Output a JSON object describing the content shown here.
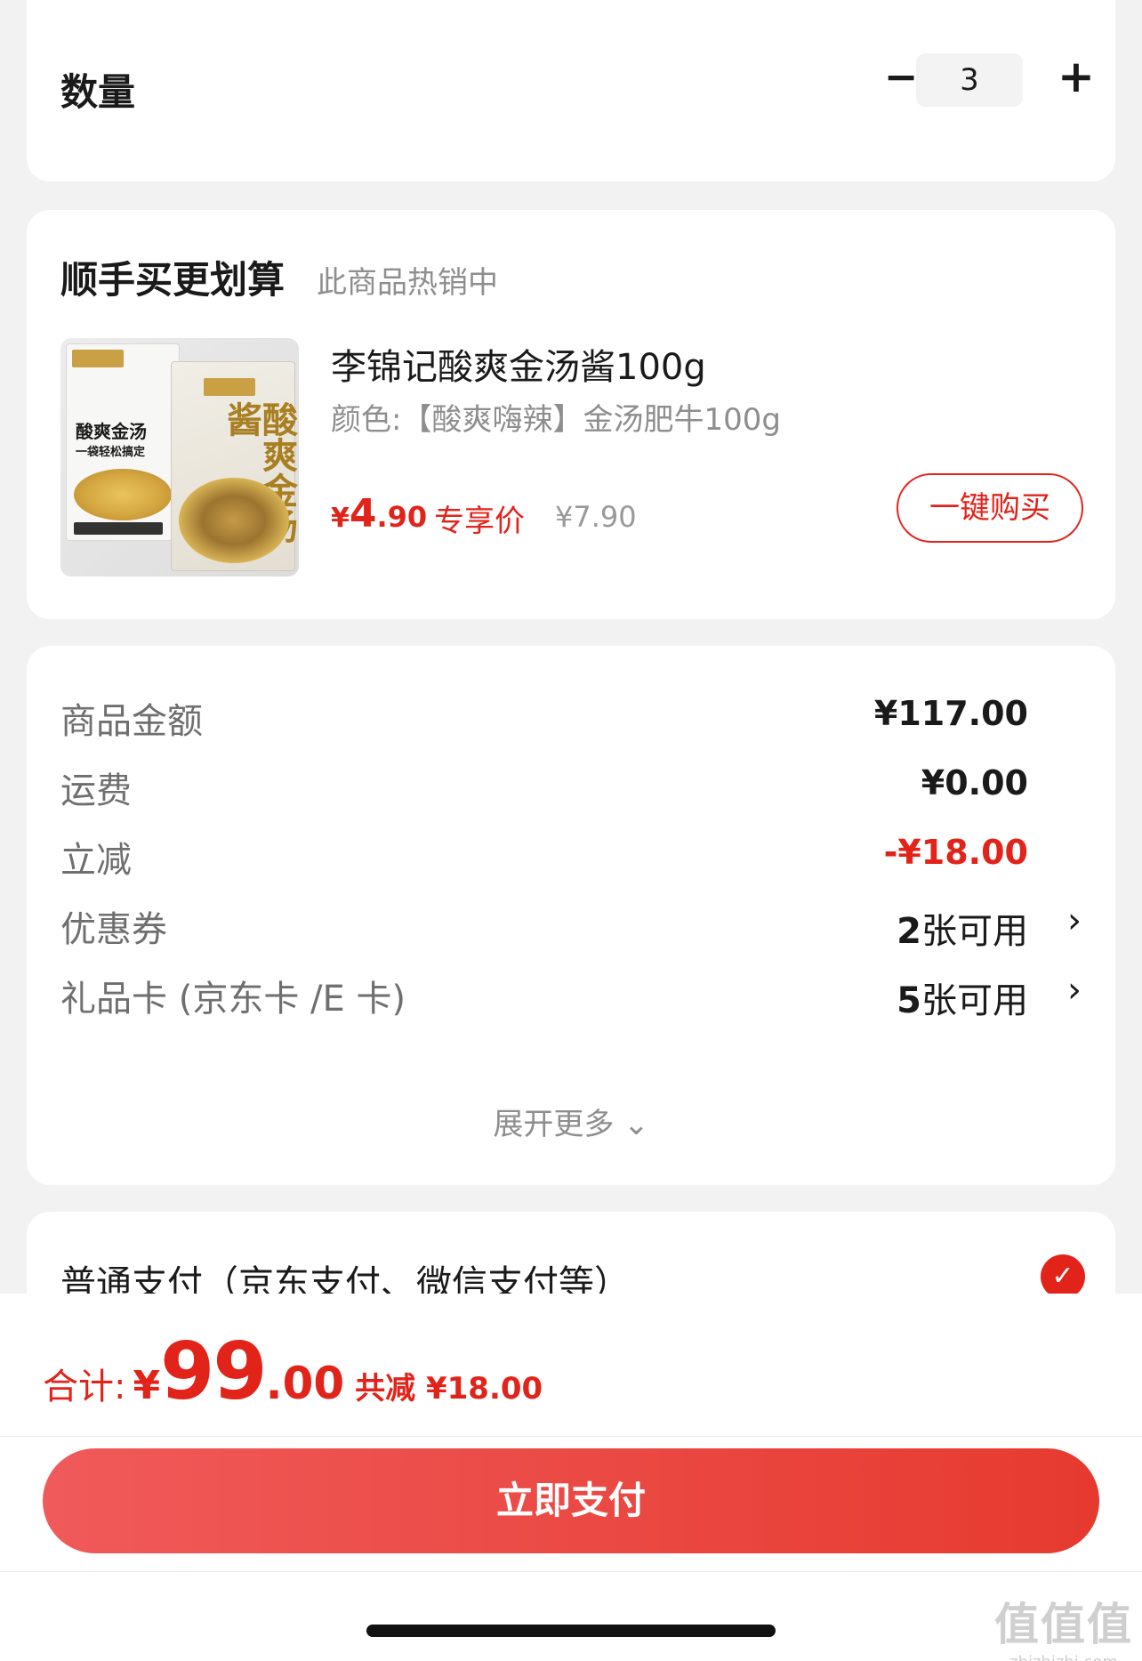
{
  "quantity": {
    "label": "数量",
    "minus": "−",
    "value": "3",
    "plus": "+"
  },
  "addon": {
    "title": "顺手买更划算",
    "subtitle": "此商品热销中",
    "product": {
      "image_icon": "product-package-image",
      "package_text_1": "酸爽金汤",
      "package_text_2": "一袋轻松搞定",
      "package_big_text": "酸爽金汤酱",
      "name": "李锦记酸爽金汤酱100g",
      "spec": "颜色:【酸爽嗨辣】金汤肥牛100g",
      "price_currency": "¥",
      "price_int": "4",
      "price_dec": ".90",
      "price_tag": "专享价",
      "original_price": "¥7.90",
      "buy_label": "一键购买"
    }
  },
  "summary": {
    "rows": [
      {
        "label": "商品金额",
        "value": "¥117.00"
      },
      {
        "label": "运费",
        "value": "¥0.00"
      },
      {
        "label": "立减",
        "value": "-¥18.00"
      },
      {
        "label": "优惠券",
        "count": "2",
        "unit": "张可用",
        "chevron": "›"
      },
      {
        "label": "礼品卡 (京东卡 /E 卡)",
        "count": "5",
        "unit": "张可用",
        "chevron": "›"
      }
    ],
    "expand_label": "展开更多 ⌄"
  },
  "payment": {
    "label": "普通支付（京东支付、微信支付等）",
    "check_icon": "✓"
  },
  "footer": {
    "total_label": "合计:",
    "total_currency": "¥",
    "total_int": "99",
    "total_dec": ".00",
    "saved_text": "共减 ¥18.00",
    "pay_button": "立即支付",
    "watermark_main": "值值值",
    "watermark_sub": "zhizhizhi.com"
  },
  "colors": {
    "accent": "#e2231a",
    "background": "#f2f2f2",
    "card": "#ffffff"
  }
}
